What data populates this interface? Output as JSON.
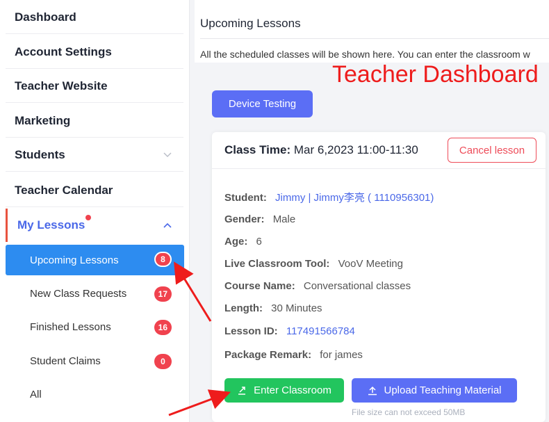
{
  "sidebar": {
    "items": [
      {
        "label": "Dashboard"
      },
      {
        "label": "Account Settings"
      },
      {
        "label": "Teacher Website"
      },
      {
        "label": "Marketing"
      },
      {
        "label": "Students"
      },
      {
        "label": "Teacher Calendar"
      },
      {
        "label": "My Lessons"
      }
    ],
    "sub_items": [
      {
        "label": "Upcoming Lessons",
        "badge": "8"
      },
      {
        "label": "New Class Requests",
        "badge": "17"
      },
      {
        "label": "Finished Lessons",
        "badge": "16"
      },
      {
        "label": "Student Claims",
        "badge": "0"
      },
      {
        "label": "All"
      }
    ]
  },
  "header": {
    "title": "Upcoming Lessons",
    "description": "All the scheduled classes will be shown here. You can enter the classroom w"
  },
  "annotation": {
    "title": "Teacher Dashboard",
    "color": "#ee1c1c"
  },
  "toolbar": {
    "device_testing": "Device Testing"
  },
  "card": {
    "class_time_label": "Class Time:",
    "class_time_value": "Mar 6,2023 11:00-11:30",
    "cancel_label": "Cancel lesson",
    "fields": {
      "student": {
        "label": "Student:",
        "value": "Jimmy | Jimmy李亮 ( 1110956301)"
      },
      "gender": {
        "label": "Gender:",
        "value": "Male"
      },
      "age": {
        "label": "Age:",
        "value": "6"
      },
      "tool": {
        "label": "Live Classroom Tool:",
        "value": "VooV Meeting"
      },
      "course": {
        "label": "Course Name:",
        "value": "Conversational classes"
      },
      "length": {
        "label": "Length:",
        "value": "30 Minutes"
      },
      "lesson_id": {
        "label": "Lesson ID:",
        "value": "117491566784"
      },
      "remark": {
        "label": "Package Remark:",
        "value": "for james"
      }
    },
    "enter_label": "Enter Classroom",
    "upload_label": "Upload Teaching Material",
    "file_note": "File size can not exceed 50MB"
  },
  "colors": {
    "primary": "#5b6ef5",
    "success": "#22c55e",
    "danger": "#ee4b58",
    "selected": "#2d8cf0",
    "link": "#4a68e8"
  }
}
